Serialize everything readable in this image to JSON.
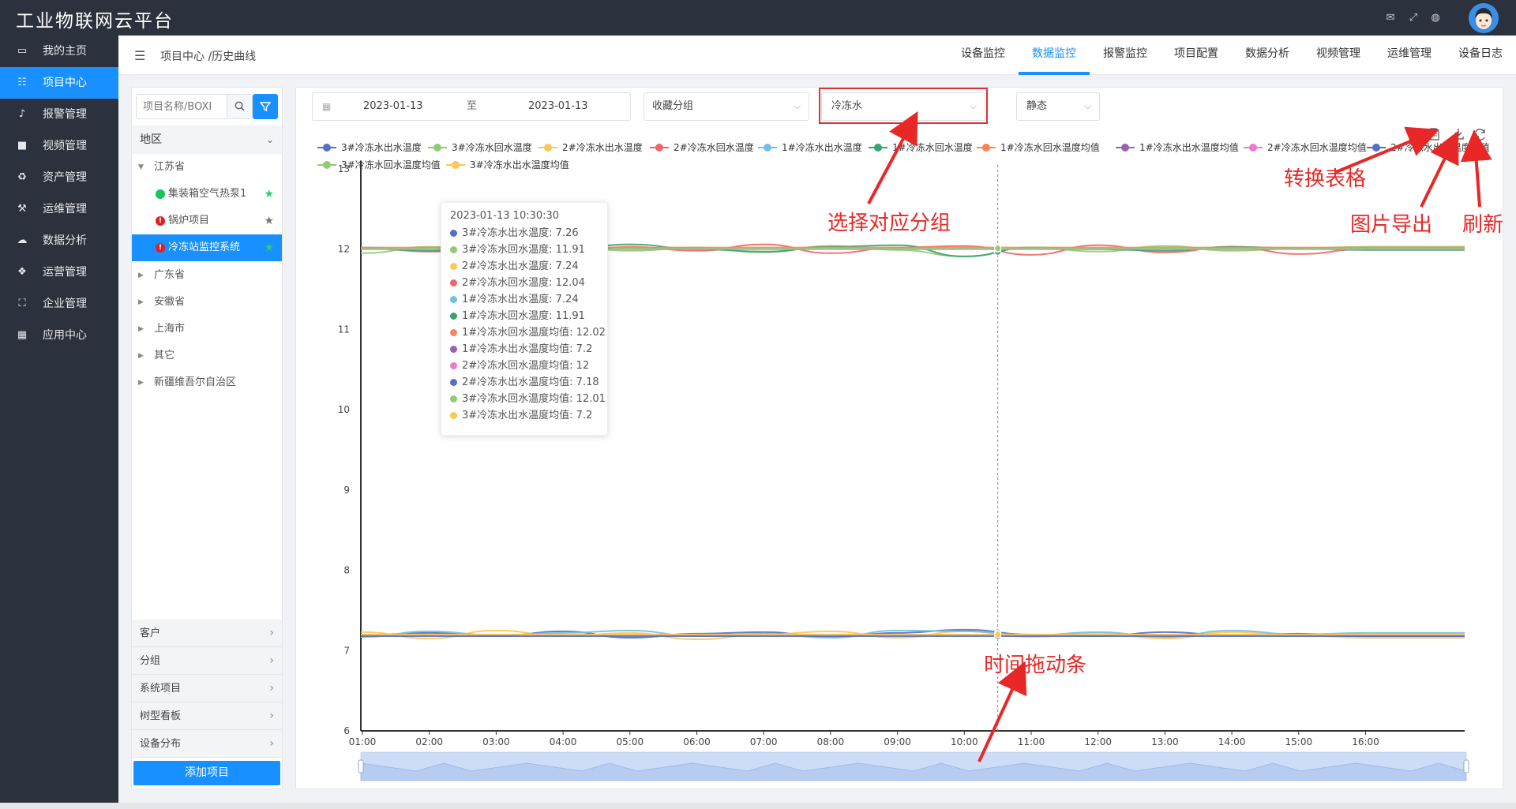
{
  "app": {
    "title": "工业物联网云平台"
  },
  "sidebar": {
    "items": [
      {
        "label": "我的主页",
        "icon": "laptop-icon",
        "active": false
      },
      {
        "label": "项目中心",
        "icon": "list-icon",
        "active": true
      },
      {
        "label": "报警管理",
        "icon": "bell-icon",
        "active": false
      },
      {
        "label": "视频管理",
        "icon": "video-camera-icon",
        "active": false
      },
      {
        "label": "资产管理",
        "icon": "recycle-icon",
        "active": false
      },
      {
        "label": "运维管理",
        "icon": "wrench-icon",
        "active": false
      },
      {
        "label": "数据分析",
        "icon": "cloud-icon",
        "active": false
      },
      {
        "label": "运营管理",
        "icon": "cubes-icon",
        "active": false
      },
      {
        "label": "企业管理",
        "icon": "sitemap-icon",
        "active": false
      },
      {
        "label": "应用中心",
        "icon": "grid-icon",
        "active": false
      }
    ]
  },
  "header": {
    "breadcrumb": "项目中心 /历史曲线",
    "tabs": [
      {
        "label": "设备监控",
        "active": false
      },
      {
        "label": "数据监控",
        "active": true
      },
      {
        "label": "报警监控",
        "active": false
      },
      {
        "label": "项目配置",
        "active": false
      },
      {
        "label": "数据分析",
        "active": false
      },
      {
        "label": "视频管理",
        "active": false
      },
      {
        "label": "运维管理",
        "active": false
      },
      {
        "label": "设备日志",
        "active": false
      }
    ]
  },
  "leftpanel": {
    "search_placeholder": "项目名称/BOXI",
    "region_label": "地区",
    "tree": [
      {
        "label": "江苏省",
        "level": 0,
        "expanded": true
      },
      {
        "label": "集装箱空气热泵1",
        "level": 1,
        "status": "online",
        "starred": true
      },
      {
        "label": "锅炉项目",
        "level": 1,
        "status": "alarm",
        "starred": false
      },
      {
        "label": "冷冻站监控系统",
        "level": 1,
        "status": "alarm",
        "starred": true,
        "selected": true
      },
      {
        "label": "广东省",
        "level": 0,
        "expanded": false
      },
      {
        "label": "安徽省",
        "level": 0,
        "expanded": false
      },
      {
        "label": "上海市",
        "level": 0,
        "expanded": false
      },
      {
        "label": "其它",
        "level": 0,
        "expanded": false
      },
      {
        "label": "新疆维吾尔自治区",
        "level": 0,
        "expanded": false
      }
    ],
    "accordion": [
      "客户",
      "分组",
      "系统项目",
      "树型看板",
      "设备分布"
    ],
    "add_button": "添加项目"
  },
  "filters": {
    "date_start": "2023-01-13",
    "date_sep": "至",
    "date_end": "2023-01-13",
    "favorite_group": "收藏分组",
    "group": "冷冻水",
    "mode": "静态"
  },
  "colors": {
    "accent": "#1890ff",
    "sidebar_bg": "#2b313d",
    "annotation": "#e82727"
  },
  "tooltip": {
    "time": "2023-01-13 10:30:30",
    "rows": [
      {
        "label": "3#冷冻水出水温度: 7.26",
        "color": "#5470c6"
      },
      {
        "label": "3#冷冻水回水温度: 11.91",
        "color": "#91cc75"
      },
      {
        "label": "2#冷冻水出水温度: 7.24",
        "color": "#fac858"
      },
      {
        "label": "2#冷冻水回水温度: 12.04",
        "color": "#ee6666"
      },
      {
        "label": "1#冷冻水出水温度: 7.24",
        "color": "#73c0de"
      },
      {
        "label": "1#冷冻水回水温度: 11.91",
        "color": "#3ba272"
      },
      {
        "label": "1#冷冻水回水温度均值: 12.02",
        "color": "#fc8452"
      },
      {
        "label": "1#冷冻水出水温度均值: 7.2",
        "color": "#9a60b4"
      },
      {
        "label": "2#冷冻水回水温度均值: 12",
        "color": "#ea7ccc"
      },
      {
        "label": "2#冷冻水出水温度均值: 7.18",
        "color": "#5470c6"
      },
      {
        "label": "3#冷冻水回水温度均值: 12.01",
        "color": "#91cc75"
      },
      {
        "label": "3#冷冻水出水温度均值: 7.2",
        "color": "#fac858"
      }
    ]
  },
  "annotations": {
    "select_group": "选择对应分组",
    "convert_table": "转换表格",
    "export_image": "图片导出",
    "refresh": "刷新",
    "time_slider": "时间拖动条"
  },
  "chart_data": {
    "type": "line",
    "x": [
      "01:00",
      "02:00",
      "03:00",
      "04:00",
      "05:00",
      "06:00",
      "07:00",
      "08:00",
      "09:00",
      "10:00",
      "11:00",
      "12:00",
      "13:00",
      "14:00",
      "15:00",
      "16:00"
    ],
    "ylim": [
      6,
      13
    ],
    "yticks": [
      6,
      7,
      8,
      9,
      10,
      11,
      12,
      13
    ],
    "cursor_x": "10:30",
    "legend_position": "top",
    "series": [
      {
        "name": "3#冷冻水出水温度",
        "color": "#5470c6",
        "values": [
          7.19,
          7.22,
          7.18,
          7.24,
          7.16,
          7.21,
          7.23,
          7.17,
          7.22,
          7.26,
          7.2,
          7.18,
          7.23,
          7.19,
          7.21,
          7.18
        ]
      },
      {
        "name": "3#冷冻水回水温度",
        "color": "#91cc75",
        "values": [
          11.95,
          12.03,
          11.97,
          12.05,
          11.98,
          12.02,
          11.96,
          12.04,
          11.99,
          11.91,
          12.02,
          11.97,
          12.04,
          11.98,
          12.01,
          12.03
        ]
      },
      {
        "name": "2#冷冻水出水温度",
        "color": "#fac858",
        "values": [
          7.23,
          7.15,
          7.25,
          7.18,
          7.22,
          7.14,
          7.2,
          7.24,
          7.16,
          7.24,
          7.17,
          7.22,
          7.15,
          7.23,
          7.19,
          7.16
        ]
      },
      {
        "name": "2#冷冻水回水温度",
        "color": "#ee6666",
        "values": [
          12.02,
          11.97,
          12.05,
          11.94,
          12.03,
          11.98,
          12.06,
          11.95,
          12.02,
          12.04,
          11.93,
          12.05,
          11.96,
          12.03,
          11.94,
          12.0
        ]
      },
      {
        "name": "1#冷冻水出水温度",
        "color": "#73c0de",
        "values": [
          7.17,
          7.24,
          7.19,
          7.22,
          7.25,
          7.18,
          7.21,
          7.16,
          7.25,
          7.24,
          7.19,
          7.23,
          7.17,
          7.25,
          7.2,
          7.22
        ]
      },
      {
        "name": "1#冷冻水回水温度",
        "color": "#3ba272",
        "values": [
          12.01,
          11.98,
          12.03,
          11.99,
          12.06,
          12.0,
          11.97,
          12.03,
          12.05,
          11.91,
          12.02,
          12.0,
          11.98,
          12.03,
          12.01,
          11.99
        ]
      },
      {
        "name": "1#冷冻水回水温度均值",
        "color": "#fc8452",
        "values": [
          12.02,
          12.02,
          12.02,
          12.02,
          12.02,
          12.02,
          12.02,
          12.02,
          12.02,
          12.02,
          12.02,
          12.02,
          12.02,
          12.02,
          12.02,
          12.02
        ]
      },
      {
        "name": "1#冷冻水出水温度均值",
        "color": "#9a60b4",
        "values": [
          7.2,
          7.2,
          7.2,
          7.2,
          7.2,
          7.2,
          7.2,
          7.2,
          7.2,
          7.2,
          7.2,
          7.2,
          7.2,
          7.2,
          7.2,
          7.2
        ]
      },
      {
        "name": "2#冷冻水回水温度均值",
        "color": "#ea7ccc",
        "values": [
          12,
          12,
          12,
          12,
          12,
          12,
          12,
          12,
          12,
          12,
          12,
          12,
          12,
          12,
          12,
          12
        ]
      },
      {
        "name": "2#冷冻水出水温度均值",
        "color": "#5470c6",
        "values": [
          7.18,
          7.18,
          7.18,
          7.18,
          7.18,
          7.18,
          7.18,
          7.18,
          7.18,
          7.18,
          7.18,
          7.18,
          7.18,
          7.18,
          7.18,
          7.18
        ]
      },
      {
        "name": "3#冷冻水回水温度均值",
        "color": "#91cc75",
        "values": [
          12.01,
          12.01,
          12.01,
          12.01,
          12.01,
          12.01,
          12.01,
          12.01,
          12.01,
          12.01,
          12.01,
          12.01,
          12.01,
          12.01,
          12.01,
          12.01
        ]
      },
      {
        "name": "3#冷冻水出水温度均值",
        "color": "#fac858",
        "values": [
          7.2,
          7.2,
          7.2,
          7.2,
          7.2,
          7.2,
          7.2,
          7.2,
          7.2,
          7.2,
          7.2,
          7.2,
          7.2,
          7.2,
          7.2,
          7.2
        ]
      }
    ]
  }
}
